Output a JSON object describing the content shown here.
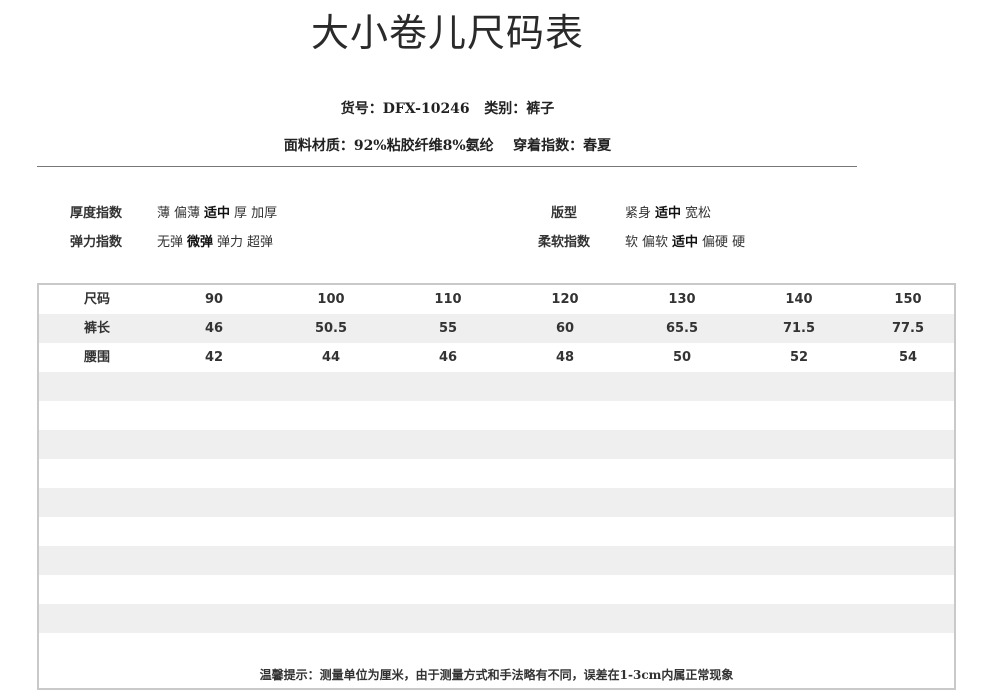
{
  "title": "大小卷儿尺码表",
  "info_line1": "货号：DFX-10246   类别：裤子",
  "info_line2": "面料材质：92%粘胶纤维8%氨纶    穿着指数：春夏",
  "attributes": [
    {
      "label": "厚度指数",
      "options": [
        "薄",
        "偏薄",
        "适中",
        "厚",
        "加厚"
      ],
      "selected": 2
    },
    {
      "label": "弹力指数",
      "options": [
        "无弹",
        "微弹",
        "弹力",
        "超弹"
      ],
      "selected": 1
    },
    {
      "label": "版型",
      "options": [
        "紧身",
        "适中",
        "宽松"
      ],
      "selected": 1
    },
    {
      "label": "柔软指数",
      "options": [
        "软",
        "偏软",
        "适中",
        "偏硬",
        "硬"
      ],
      "selected": 2
    }
  ],
  "size_table": {
    "rows": [
      {
        "label": "尺码",
        "values": [
          "90",
          "100",
          "110",
          "120",
          "130",
          "140",
          "150"
        ]
      },
      {
        "label": "裤长",
        "values": [
          "46",
          "50.5",
          "55",
          "60",
          "65.5",
          "71.5",
          "77.5"
        ]
      },
      {
        "label": "腰围",
        "values": [
          "42",
          "44",
          "46",
          "48",
          "50",
          "52",
          "54"
        ]
      }
    ],
    "empty_rows": 10
  },
  "note": "温馨提示：测量单位为厘米，由于测量方式和手法略有不同，误差在1-3cm内属正常现象",
  "colors": {
    "stripe": "#efefef",
    "border": "#c9c9c9",
    "divider": "#777777"
  }
}
